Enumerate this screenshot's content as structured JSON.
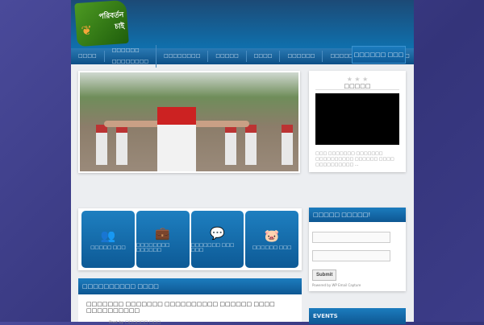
{
  "logo": {
    "line1": "পরিবর্তন",
    "line2": "চাই"
  },
  "nav": {
    "items": [
      "□□□□",
      "□□□□□□ □□□□□□□□",
      "□□□□□□□□",
      "□□□□□",
      "□□□□",
      "□□□□□□",
      "□□□□□□□□□",
      "□□□□□"
    ],
    "cta": "□□□□□□ □□□"
  },
  "video": {
    "stars": "★ ★ ★",
    "title": "□□□□□",
    "desc": "□□□ □□□□□□□ □□□□□□□ □□□□□□□□□□ □□□□□□ □□□□ □□□□□□□□□□ ..."
  },
  "features": [
    {
      "icon": "people-icon",
      "label": "□□□□□ □□□"
    },
    {
      "icon": "briefcase-icon",
      "label": "□□□□□□□□ □□□□□□"
    },
    {
      "icon": "chat-icon",
      "label": "□□□□□□□ □□□ □□□"
    },
    {
      "icon": "piggy-bank-icon",
      "label": "□□□□□□ □□□"
    }
  ],
  "recent": {
    "title": "□□□□□□□□□□ □□□□",
    "post_title": "□□□□□□□ □□□□□□□ □□□□□□□□□□ □□□□□□ □□□□ □□□□□□□□□□",
    "post_by": "Post by □□□□□□ □□□"
  },
  "email": {
    "title": "□□□□□ □□□□□!",
    "submit": "Submit",
    "powered": "Powered by WP Email Capture"
  },
  "events": {
    "title": "EVENTS"
  }
}
